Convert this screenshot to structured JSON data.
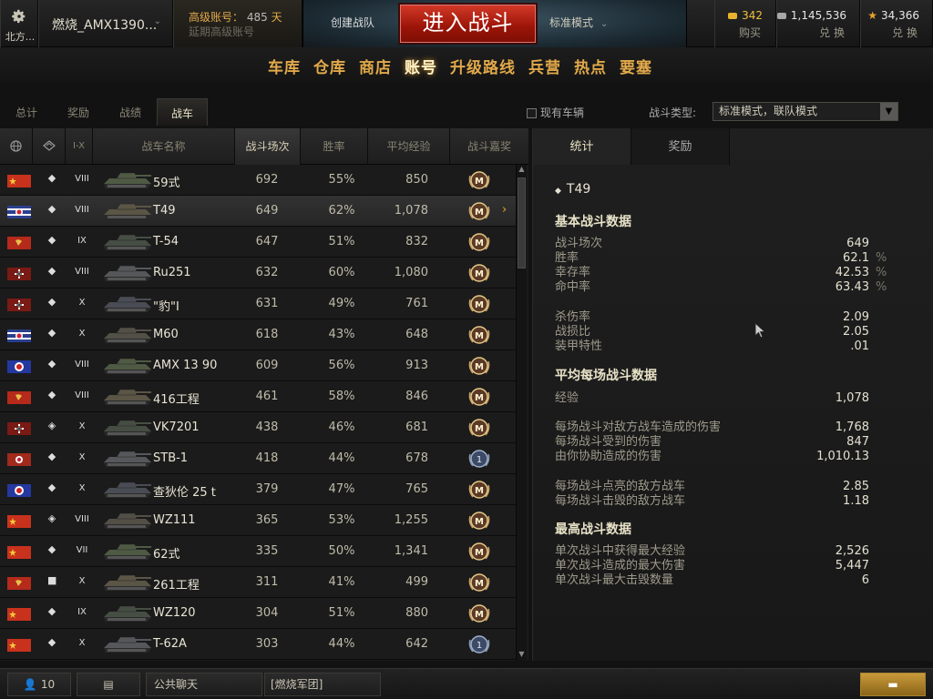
{
  "topbar": {
    "server": "北方...",
    "username": "燃烧_AMX1390...",
    "premium_line1": "高级账号：",
    "premium_days": "485",
    "premium_days_unit": "天",
    "premium_line2": "延期高级账号",
    "create_platoon": "创建战队",
    "battle_button": "进入战斗",
    "battle_mode": "标准模式",
    "gold": {
      "value": "342",
      "action": "购买"
    },
    "credits": {
      "value": "1,145,536",
      "action": "兑 换"
    },
    "free_xp": {
      "value": "34,366",
      "action": "兑 换"
    }
  },
  "nav": [
    "车库",
    "仓库",
    "商店",
    "账号",
    "升级路线",
    "兵营",
    "热点",
    "要塞"
  ],
  "nav_active": 3,
  "subtabs": [
    "总计",
    "奖励",
    "战绩",
    "战车"
  ],
  "subtab_active": 3,
  "filter": {
    "owned_label": "现有车辆",
    "battle_type_label": "战斗类型:",
    "battle_type_value": "标准模式，联队模式"
  },
  "table": {
    "headers": {
      "tier": "I-X",
      "name": "战车名称",
      "battles": "战斗场次",
      "win": "胜率",
      "xp": "平均经验",
      "mastery": "战斗嘉奖"
    },
    "rows": [
      {
        "nation": "china",
        "type": "◆",
        "tier": "VIII",
        "name": "59式",
        "battles": "692",
        "win": "55%",
        "xp": "850",
        "mastery": "M"
      },
      {
        "nation": "usa",
        "type": "◆",
        "tier": "VIII",
        "name": "T49",
        "battles": "649",
        "win": "62%",
        "xp": "1,078",
        "mastery": "M",
        "selected": true
      },
      {
        "nation": "ussr",
        "type": "◆",
        "tier": "IX",
        "name": "T-54",
        "battles": "647",
        "win": "51%",
        "xp": "832",
        "mastery": "M"
      },
      {
        "nation": "germany",
        "type": "◆",
        "tier": "VIII",
        "name": "Ru251",
        "battles": "632",
        "win": "60%",
        "xp": "1,080",
        "mastery": "M"
      },
      {
        "nation": "germany",
        "type": "◆",
        "tier": "X",
        "name": "\"豹\"I",
        "battles": "631",
        "win": "49%",
        "xp": "761",
        "mastery": "M"
      },
      {
        "nation": "usa",
        "type": "◆",
        "tier": "X",
        "name": "M60",
        "battles": "618",
        "win": "43%",
        "xp": "648",
        "mastery": "M"
      },
      {
        "nation": "france",
        "type": "◆",
        "tier": "VIII",
        "name": "AMX 13 90",
        "battles": "609",
        "win": "56%",
        "xp": "913",
        "mastery": "M"
      },
      {
        "nation": "ussr",
        "type": "◆",
        "tier": "VIII",
        "name": "416工程",
        "battles": "461",
        "win": "58%",
        "xp": "846",
        "mastery": "M"
      },
      {
        "nation": "germany",
        "type": "◈",
        "tier": "X",
        "name": "VK7201",
        "battles": "438",
        "win": "46%",
        "xp": "681",
        "mastery": "M"
      },
      {
        "nation": "germany2",
        "type": "◆",
        "tier": "X",
        "name": "STB-1",
        "battles": "418",
        "win": "44%",
        "xp": "678",
        "mastery": "1"
      },
      {
        "nation": "france",
        "type": "◆",
        "tier": "X",
        "name": "查狄伦 25 t",
        "battles": "379",
        "win": "47%",
        "xp": "765",
        "mastery": "M"
      },
      {
        "nation": "china",
        "type": "◈",
        "tier": "VIII",
        "name": "WZ111",
        "battles": "365",
        "win": "53%",
        "xp": "1,255",
        "mastery": "M"
      },
      {
        "nation": "china",
        "type": "◆",
        "tier": "VII",
        "name": "62式",
        "battles": "335",
        "win": "50%",
        "xp": "1,341",
        "mastery": "M"
      },
      {
        "nation": "ussr",
        "type": "■",
        "tier": "X",
        "name": "261工程",
        "battles": "311",
        "win": "41%",
        "xp": "499",
        "mastery": "M"
      },
      {
        "nation": "china",
        "type": "◆",
        "tier": "IX",
        "name": "WZ120",
        "battles": "304",
        "win": "51%",
        "xp": "880",
        "mastery": "M"
      },
      {
        "nation": "china",
        "type": "◆",
        "tier": "X",
        "name": "T-62A",
        "battles": "303",
        "win": "44%",
        "xp": "642",
        "mastery": "1"
      }
    ]
  },
  "details": {
    "tabs": [
      "统计",
      "奖励"
    ],
    "vehicle": "T49",
    "vehicle_marker": "◆",
    "basic_title": "基本战斗数据",
    "basic": [
      {
        "label": "战斗场次",
        "value": "649",
        "suffix": ""
      },
      {
        "label": "胜率",
        "value": "62.1",
        "suffix": "%"
      },
      {
        "label": "幸存率",
        "value": "42.53",
        "suffix": "%"
      },
      {
        "label": "命中率",
        "value": "63.43",
        "suffix": "%"
      }
    ],
    "ratios": [
      {
        "label": "杀伤率",
        "value": "2.09"
      },
      {
        "label": "战损比",
        "value": "2.05"
      },
      {
        "label": "装甲特性",
        "value": ".01"
      }
    ],
    "avg_title": "平均每场战斗数据",
    "avg_xp": {
      "label": "经验",
      "value": "1,078"
    },
    "avg_dmg": [
      {
        "label": "每场战斗对敌方战车造成的伤害",
        "value": "1,768"
      },
      {
        "label": "每场战斗受到的伤害",
        "value": "847"
      },
      {
        "label": "由你协助造成的伤害",
        "value": "1,010.13"
      }
    ],
    "avg_spot": [
      {
        "label": "每场战斗点亮的敌方战车",
        "value": "2.85"
      },
      {
        "label": "每场战斗击毁的敌方战车",
        "value": "1.18"
      }
    ],
    "max_title": "最高战斗数据",
    "max": [
      {
        "label": "单次战斗中获得最大经验",
        "value": "2,526"
      },
      {
        "label": "单次战斗造成的最大伤害",
        "value": "5,447"
      },
      {
        "label": "单次战斗最大击毁数量",
        "value": "6"
      }
    ]
  },
  "bottom": {
    "friends_count": "10",
    "public_chat": "公共聊天",
    "clan_chat": "[燃烧军团]"
  },
  "colors": {
    "accent": "#e2a94a",
    "battle_red": "#b01e10",
    "gold": "#f0b030"
  }
}
